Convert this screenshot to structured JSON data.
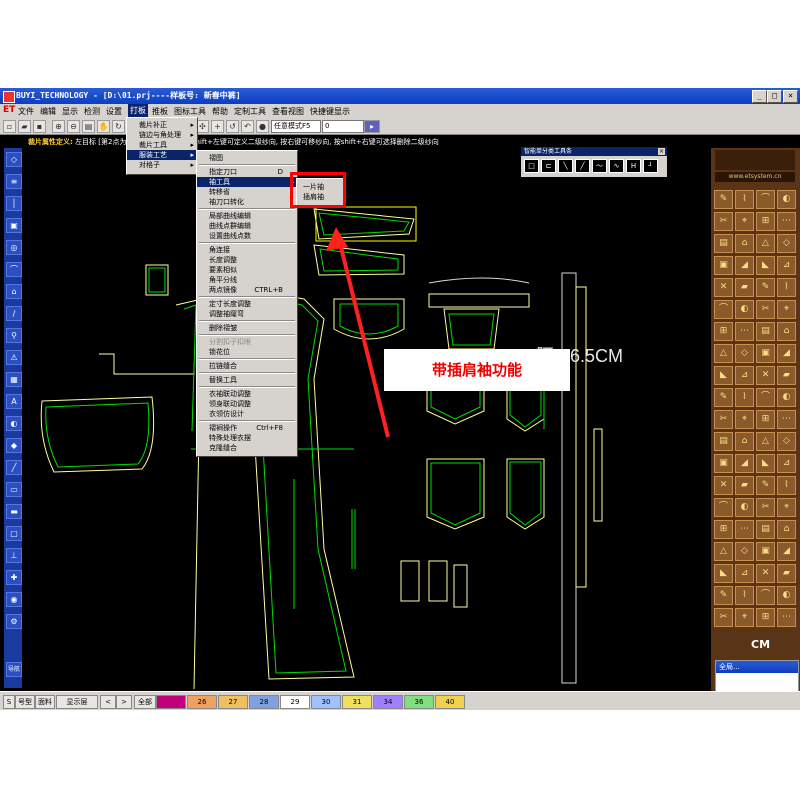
{
  "window": {
    "title": "BUYI_TECHNOLOGY - [D:\\01.prj----样板号: 新春中裤]",
    "controls": [
      "_",
      "□",
      "×"
    ]
  },
  "menubar": {
    "logo": "ET",
    "items": [
      "文件",
      "编辑",
      "显示",
      "检测",
      "设置",
      "打板",
      "推板",
      "图标工具",
      "帮助",
      "定制工具",
      "查看视图",
      "快捷键显示"
    ],
    "active": "打板"
  },
  "toolbar": {
    "mode_select": "任意模式F5",
    "value_input": "0"
  },
  "infobar": {
    "label": "裁片属性定义:",
    "text": "左目标   [第2点为纱向箭头方向] , 按住shift+左键可定义二级纱向, 按右键可移纱向, 按shift+右键可选择删除二级纱向"
  },
  "menus": {
    "level1": [
      {
        "label": "裁片补正",
        "arrow": "▸"
      },
      {
        "label": "链边与角处理",
        "arrow": "▸"
      },
      {
        "label": "裁片工具",
        "arrow": "▸"
      },
      {
        "label": "服装工艺",
        "arrow": "▸",
        "highlight": true
      },
      {
        "label": "对格子",
        "arrow": "▸"
      }
    ],
    "level2": [
      {
        "label": "褶图"
      },
      {
        "sep": true
      },
      {
        "label": "指定刀口",
        "key": "D"
      },
      {
        "label": "袖工具",
        "highlight": true,
        "arrow": "▸"
      },
      {
        "label": "转移省"
      },
      {
        "label": "袖刀口转化"
      },
      {
        "sep": true
      },
      {
        "label": "局部曲线编辑"
      },
      {
        "label": "曲线点群编辑"
      },
      {
        "label": "设置曲线点数"
      },
      {
        "sep": true
      },
      {
        "label": "角连接"
      },
      {
        "label": "长度调整"
      },
      {
        "label": "要素相似"
      },
      {
        "label": "角平分线"
      },
      {
        "label": "两点镜像",
        "key": "CTRL+B"
      },
      {
        "sep": true
      },
      {
        "label": "定寸长度调整"
      },
      {
        "label": "调整袖窿弯"
      },
      {
        "sep": true
      },
      {
        "label": "删除褶皱"
      },
      {
        "sep": true
      },
      {
        "label": "分割扣子扣眼",
        "disabled": true
      },
      {
        "label": "锁花位"
      },
      {
        "sep": true
      },
      {
        "label": "拉链缝合"
      },
      {
        "sep": true
      },
      {
        "label": "替换工具"
      },
      {
        "sep": true
      },
      {
        "label": "衣袖联动调整"
      },
      {
        "label": "领身联动调整"
      },
      {
        "label": "衣领仿设计"
      },
      {
        "sep": true
      },
      {
        "label": "褶裥操作",
        "key": "Ctrl+F8"
      },
      {
        "label": "特殊处理衣摆"
      },
      {
        "label": "克隆缝合"
      }
    ],
    "level3": [
      "一片袖",
      "插肩袖"
    ]
  },
  "floating_toolbar": {
    "title": "智能单分类工具条",
    "buttons": [
      "□",
      "⊏",
      "╲",
      "╱",
      "〜",
      "∿",
      "H",
      "┘"
    ]
  },
  "annotations": {
    "callout": "带插肩袖功能",
    "waist_label": "腰4-6.5CM"
  },
  "right_panel": {
    "url": "www.etsystem.cn",
    "brand": "CM",
    "preview_title": "全局..."
  },
  "statusbar": {
    "items": [
      "S",
      "号型",
      "面料",
      "显示层",
      "<",
      ">",
      "全部"
    ],
    "layers": [
      {
        "label": "",
        "color": "#c0007a"
      },
      {
        "label": "26",
        "color": "#f0a060"
      },
      {
        "label": "27",
        "color": "#f0c060"
      },
      {
        "label": "28",
        "color": "#80a0e0"
      },
      {
        "label": "29",
        "color": "#fff"
      },
      {
        "label": "30",
        "color": "#a0c0ff"
      },
      {
        "label": "31",
        "color": "#f0e060"
      },
      {
        "label": "34",
        "color": "#a080ff"
      },
      {
        "label": "36",
        "color": "#80e080"
      },
      {
        "label": "40",
        "color": "#f0d050"
      }
    ]
  },
  "left_toolbar": {
    "last_label": "导航"
  },
  "colors": {
    "pattern_line": "#ffffa0",
    "pattern_fill": "#00dd00",
    "cutline": "#d8d8d8",
    "highlight_box": "#ff0000",
    "arrow": "#ff2020"
  }
}
